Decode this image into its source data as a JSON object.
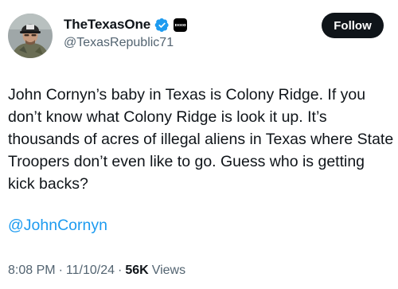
{
  "author": {
    "display_name": "TheTexasOne",
    "handle": "@TexasRepublic71",
    "verified_color": "#1d9bf0",
    "avatar_icon": "man-in-cap-avatar"
  },
  "follow_label": "Follow",
  "tweet": {
    "text": "John Cornyn’s baby in Texas is Colony Ridge. If you don’t know what Colony Ridge is look it up. It’s thousands of acres of illegal aliens in Texas where State Troopers don’t even like to go. Guess who is getting kick backs?",
    "mention": "@JohnCornyn"
  },
  "meta": {
    "time": "8:08 PM",
    "date": "11/10/24",
    "separator": "·",
    "views_count": "56K",
    "views_label": "Views"
  },
  "colors": {
    "text": "#0f1419",
    "secondary": "#536471",
    "link": "#1d9bf0"
  }
}
